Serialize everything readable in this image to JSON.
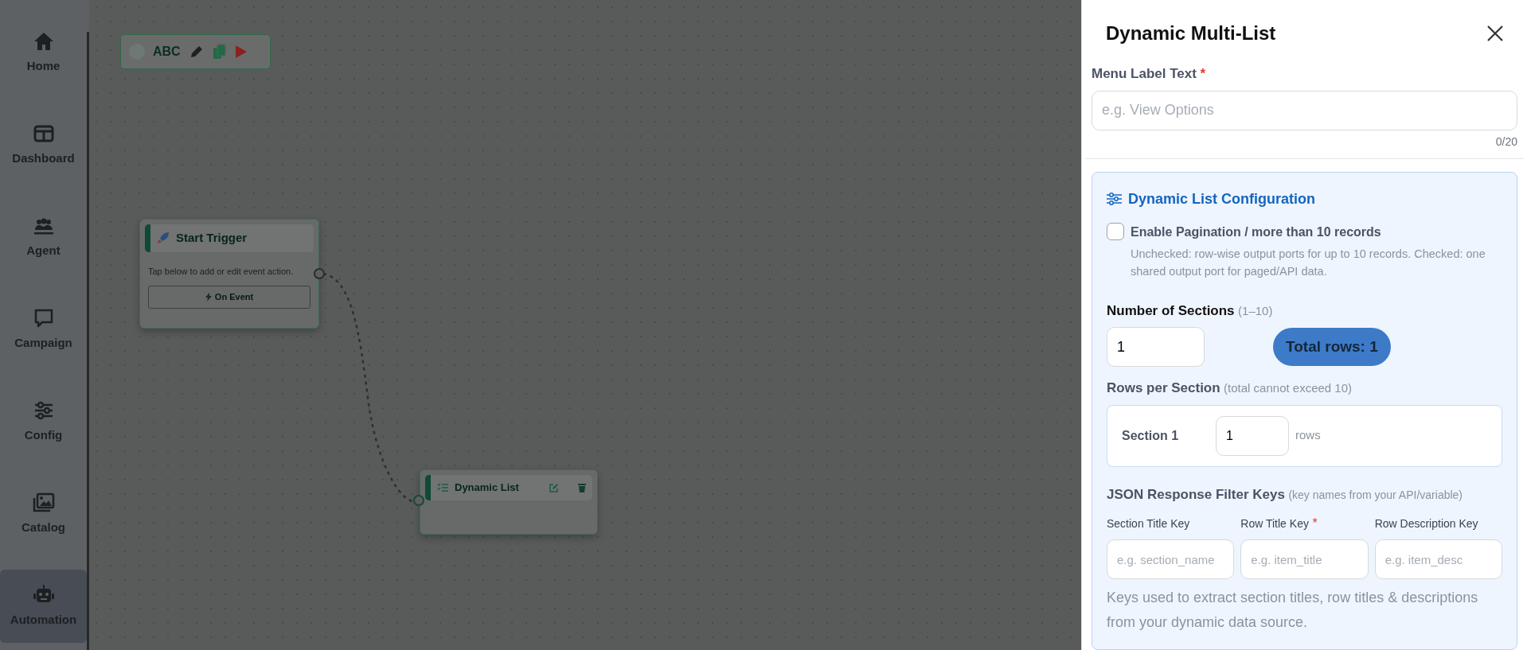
{
  "sidebar": {
    "items": [
      {
        "label": "Home",
        "selected": false
      },
      {
        "label": "Dashboard",
        "selected": false
      },
      {
        "label": "Agent",
        "selected": false
      },
      {
        "label": "Campaign",
        "selected": false
      },
      {
        "label": "Config",
        "selected": false
      },
      {
        "label": "Catalog",
        "selected": false
      },
      {
        "label": "Automation",
        "selected": true
      }
    ]
  },
  "toolbar": {
    "label": "ABC"
  },
  "nodes": [
    {
      "kind": "trigger",
      "title": "Start Trigger",
      "description": "Tap below to add or edit event action.",
      "button": "On Event"
    },
    {
      "kind": "list",
      "title": "Dynamic List"
    }
  ],
  "panel": {
    "title": "Dynamic Multi-List",
    "menu_label": {
      "label": "Menu Label Text",
      "required_mark": "*",
      "placeholder": "e.g. View Options",
      "counter": "0/20"
    },
    "config": {
      "title": "Dynamic List Configuration",
      "pagination": {
        "label": "Enable Pagination / more than 10 records",
        "checked": false,
        "help": "Unchecked: row-wise output ports for up to 10 records. Checked: one shared output port for paged/API data."
      },
      "sections": {
        "label": "Number of Sections",
        "hint": "(1–10)",
        "value": "1",
        "total": "Total rows: 1"
      },
      "rows_per_section": {
        "label": "Rows per Section",
        "hint": "(total cannot exceed 10)",
        "rows": [
          {
            "name": "Section 1",
            "value": "1",
            "unit": "rows"
          }
        ]
      },
      "filter_keys": {
        "label": "JSON Response Filter Keys",
        "hint": "(key names from your API/variable)",
        "fields": [
          {
            "label": "Section Title Key",
            "placeholder": "e.g. section_name"
          },
          {
            "label": "Row Title Key",
            "required_mark": "*",
            "placeholder": "e.g. item_title"
          },
          {
            "label": "Row Description Key",
            "placeholder": "e.g. item_desc"
          }
        ],
        "note": "Keys used to extract section titles, row titles & descriptions from your dynamic data source."
      }
    }
  }
}
